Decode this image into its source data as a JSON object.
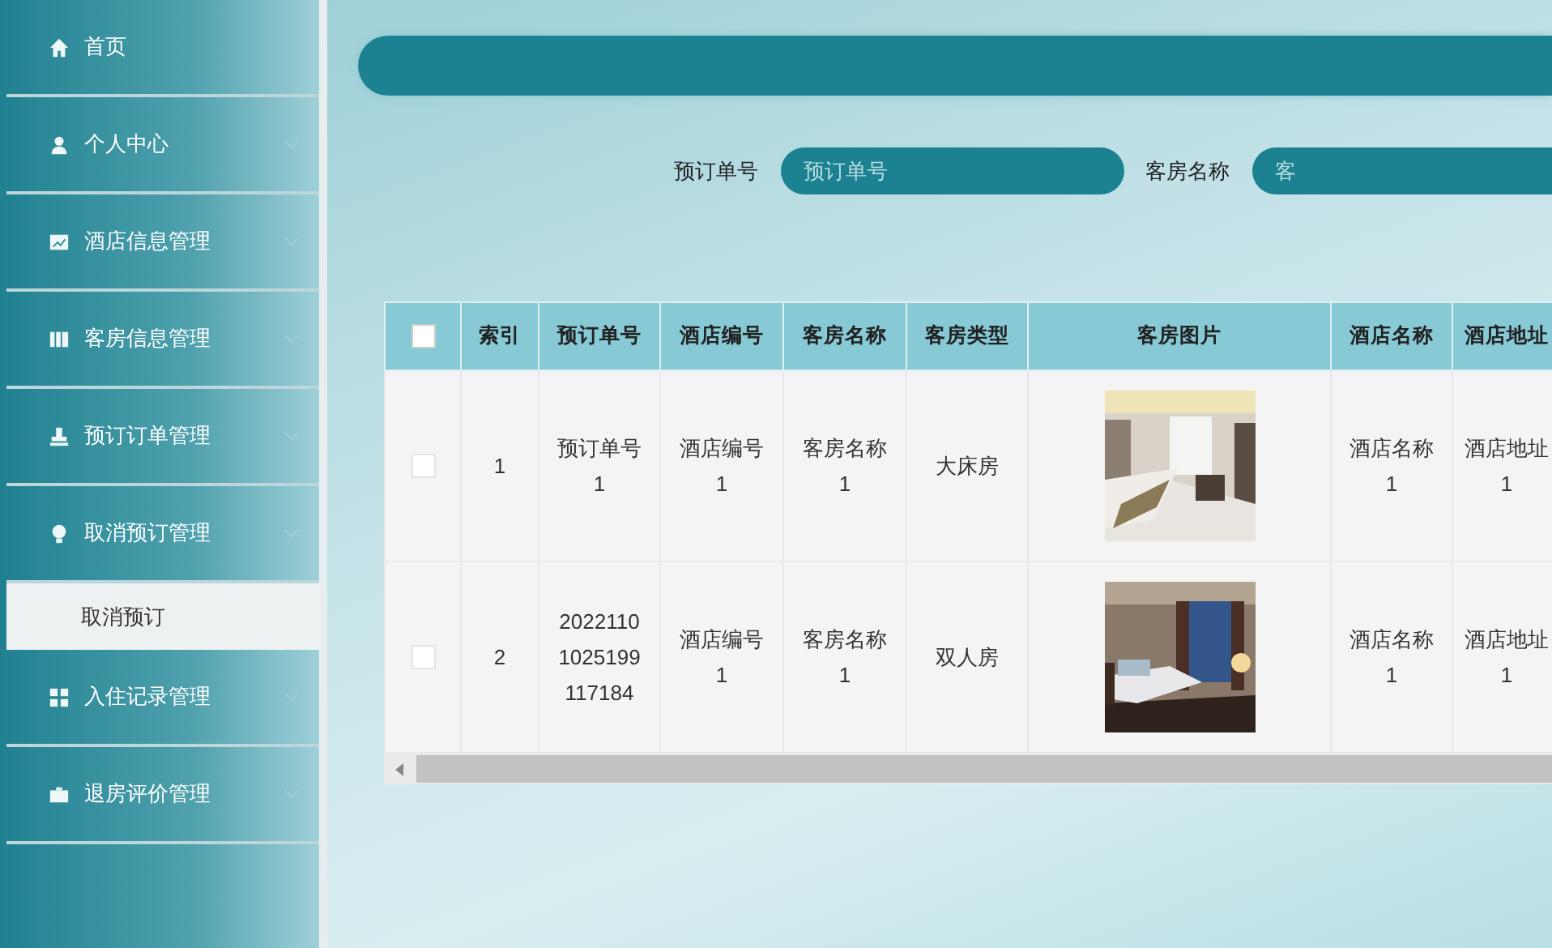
{
  "sidebar": {
    "items": [
      {
        "label": "首页",
        "kind": "link"
      },
      {
        "label": "个人中心",
        "kind": "submenu"
      },
      {
        "label": "酒店信息管理",
        "kind": "submenu"
      },
      {
        "label": "客房信息管理",
        "kind": "submenu"
      },
      {
        "label": "预订订单管理",
        "kind": "submenu"
      },
      {
        "label": "取消预订管理",
        "kind": "submenu",
        "children": [
          {
            "label": "取消预订",
            "selected": true
          }
        ]
      },
      {
        "label": "入住记录管理",
        "kind": "submenu"
      },
      {
        "label": "退房评价管理",
        "kind": "submenu"
      }
    ]
  },
  "search": {
    "fields": [
      {
        "label": "预订单号",
        "placeholder": "预订单号"
      },
      {
        "label": "客房名称",
        "placeholder": "客"
      }
    ]
  },
  "table": {
    "all_checked": false,
    "columns": [
      {
        "label": "索引"
      },
      {
        "label": "预订单号"
      },
      {
        "label": "酒店编号"
      },
      {
        "label": "客房名称"
      },
      {
        "label": "客房类型"
      },
      {
        "label": "客房图片"
      },
      {
        "label": "酒店名称"
      },
      {
        "label": "酒店地址"
      }
    ],
    "rows": [
      {
        "selected": false,
        "cells": [
          "1",
          "预订单号1",
          "酒店编号1",
          "客房名称1",
          "大床房",
          {
            "kind": "picture"
          },
          "酒店名称1",
          "酒店地址1"
        ]
      },
      {
        "selected": false,
        "cells": [
          "2",
          "20221101025199117184",
          "酒店编号1",
          "客房名称1",
          "双人房",
          {
            "kind": "picture"
          },
          "酒店名称1",
          "酒店地址1"
        ]
      }
    ]
  }
}
